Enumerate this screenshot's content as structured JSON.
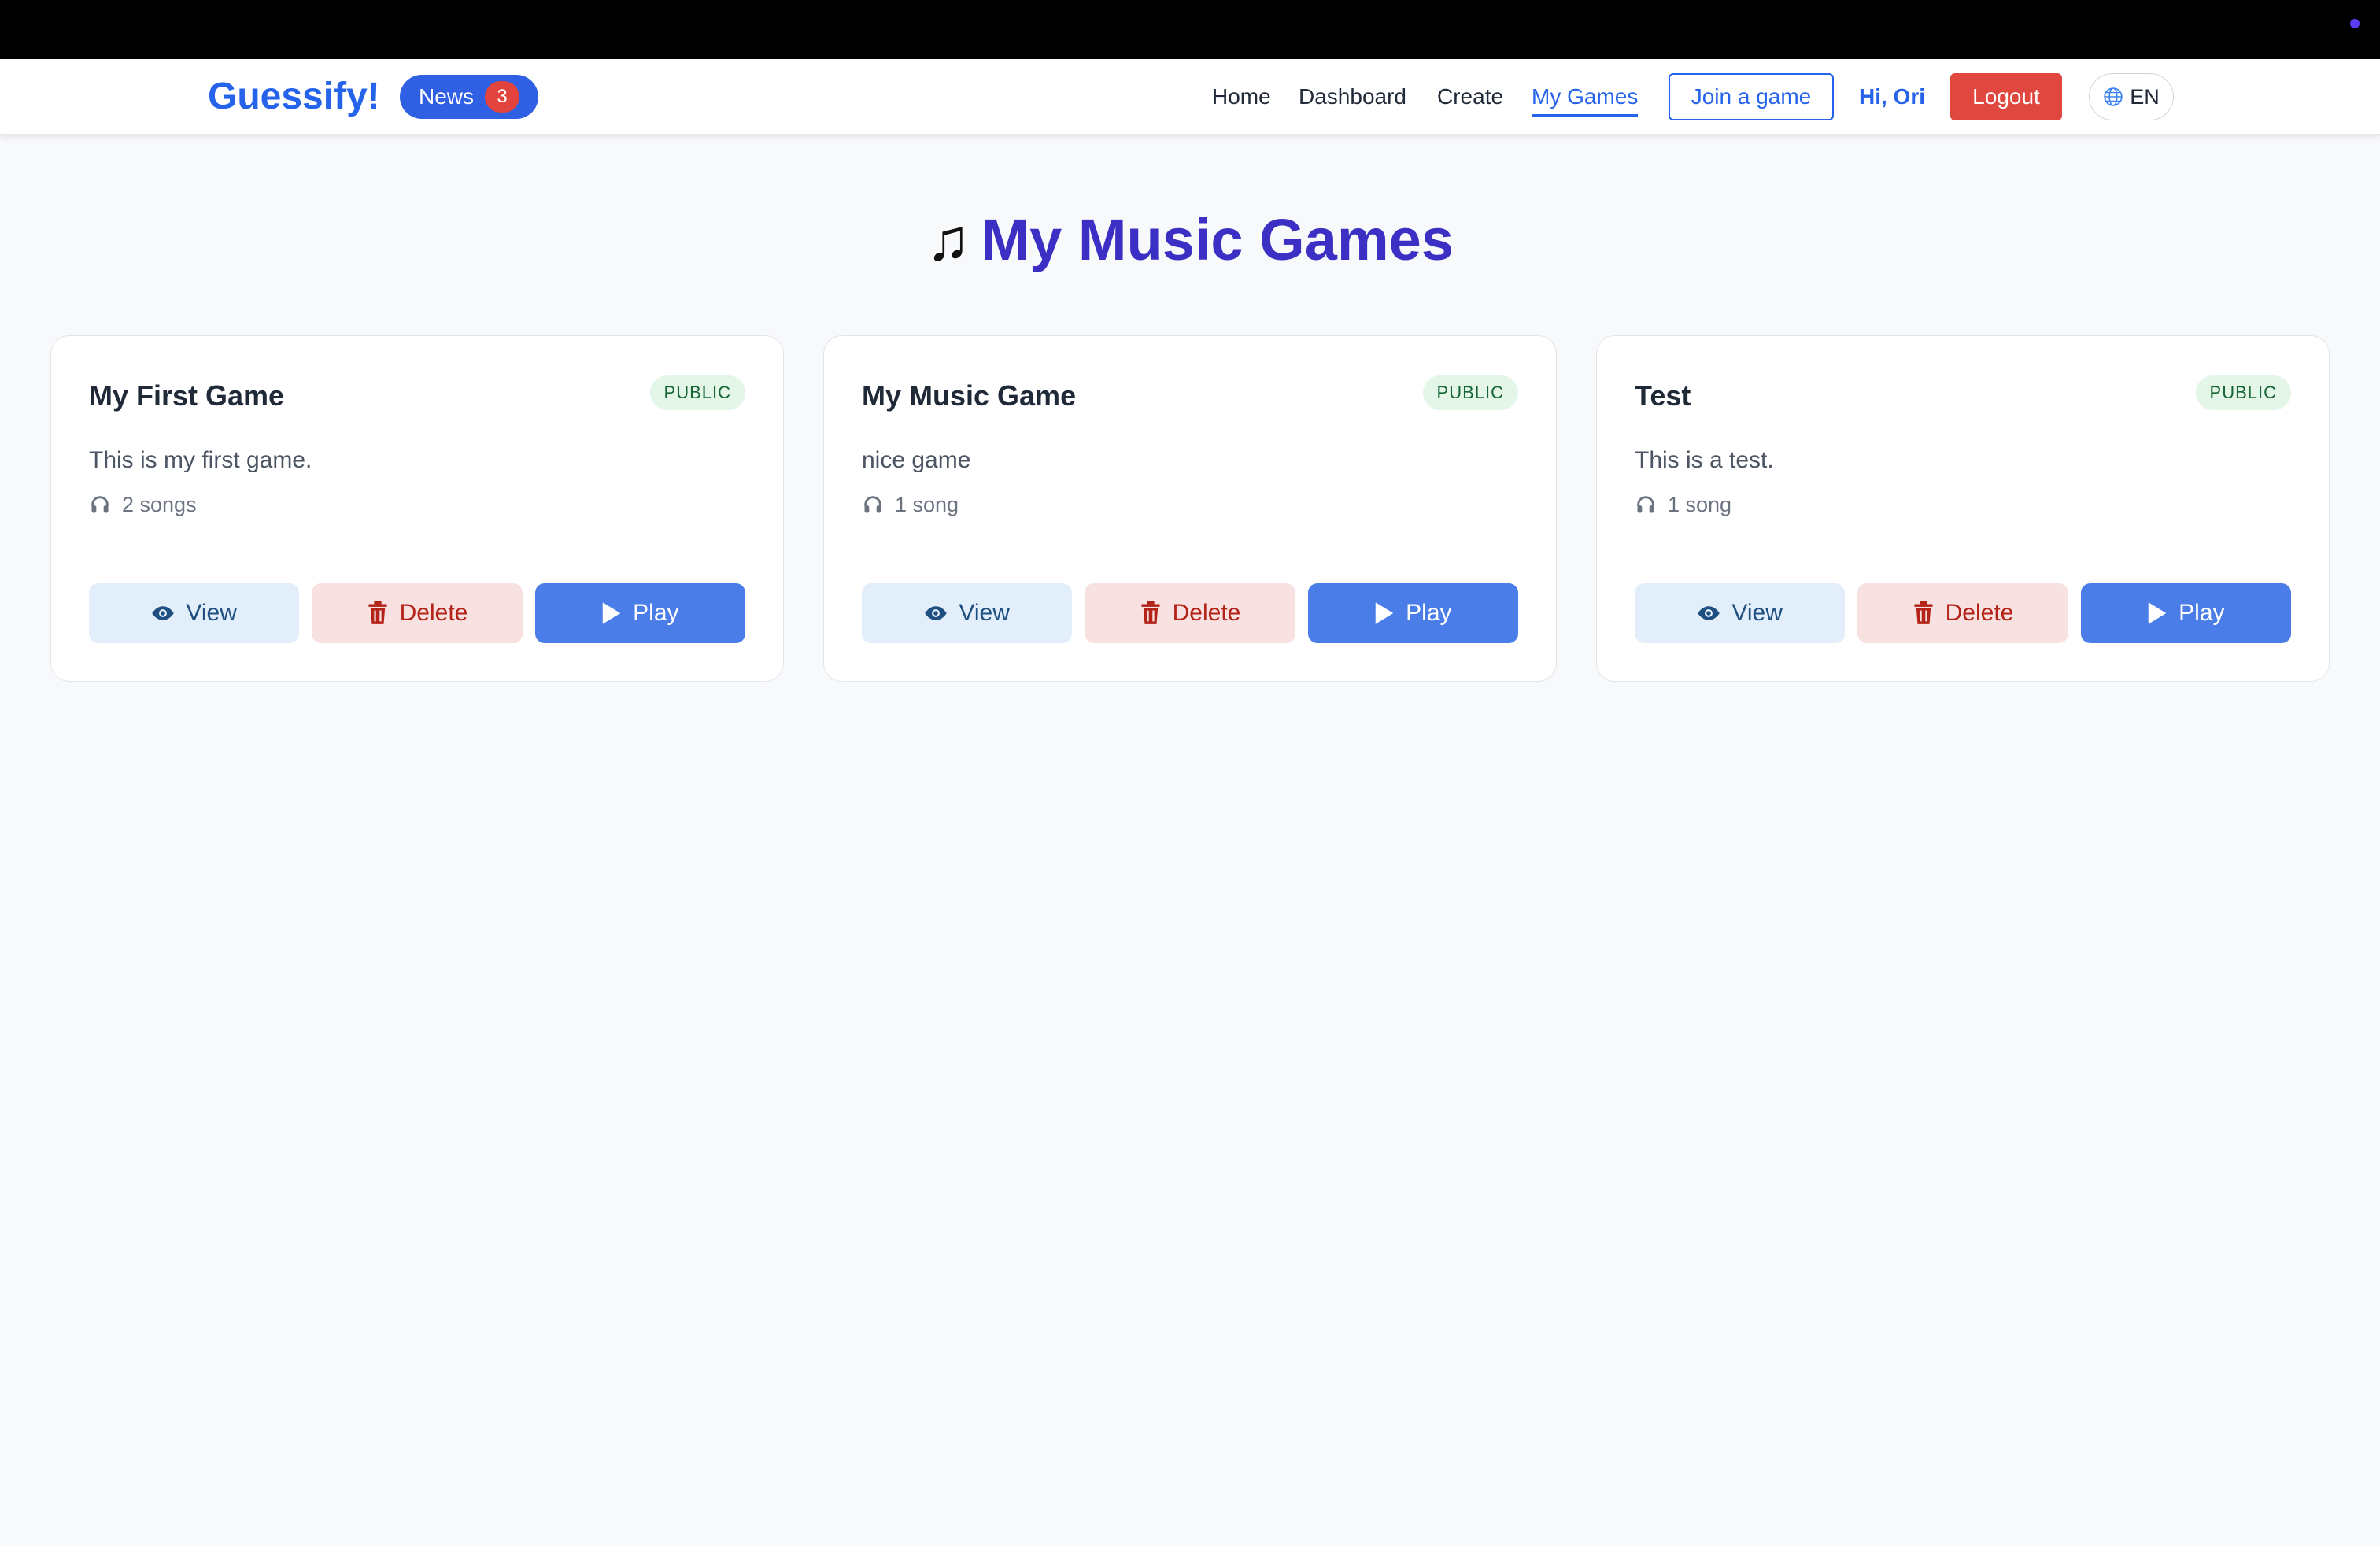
{
  "navbar": {
    "brand": "Guessify!",
    "news_label": "News",
    "news_count": "3",
    "links": [
      "Home",
      "Dashboard",
      "Create",
      "My Games"
    ],
    "active_link": "My Games",
    "join_label": "Join a game",
    "greeting": "Hi, Ori",
    "logout_label": "Logout",
    "language": "EN"
  },
  "page": {
    "title": "My Music Games",
    "title_icon": "music-note-icon"
  },
  "cards": [
    {
      "title": "My First Game",
      "badge": "PUBLIC",
      "description": "This is my first game.",
      "songs": "2 songs",
      "view_label": "View",
      "delete_label": "Delete",
      "play_label": "Play"
    },
    {
      "title": "My Music Game",
      "badge": "PUBLIC",
      "description": "nice game",
      "songs": "1 song",
      "view_label": "View",
      "delete_label": "Delete",
      "play_label": "Play"
    },
    {
      "title": "Test",
      "badge": "PUBLIC",
      "description": "This is a test.",
      "songs": "1 song",
      "view_label": "View",
      "delete_label": "Delete",
      "play_label": "Play"
    }
  ],
  "colors": {
    "brand": "#2563eb",
    "title": "#3b2fc4",
    "logout": "#e0483f",
    "play": "#4a7de8",
    "public_badge_bg": "#e3f6e8"
  }
}
